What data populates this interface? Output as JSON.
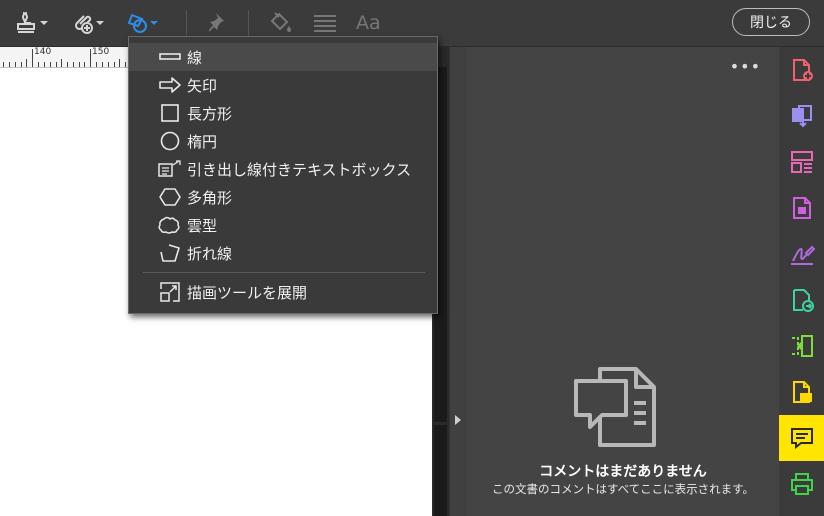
{
  "toolbar": {
    "icons": [
      "stamp-icon",
      "attach-icon",
      "draw-shapes-icon",
      "pin-icon",
      "fill-icon",
      "line-style-icon",
      "font-icon"
    ],
    "font_label": "Aa",
    "close_label": "閉じる"
  },
  "ruler": {
    "labels": [
      "140",
      "150"
    ]
  },
  "menu": {
    "items": [
      {
        "icon": "line-icon",
        "label": "線"
      },
      {
        "icon": "arrow-icon",
        "label": "矢印"
      },
      {
        "icon": "rectangle-icon",
        "label": "長方形"
      },
      {
        "icon": "ellipse-icon",
        "label": "楕円"
      },
      {
        "icon": "text-callout-icon",
        "label": "引き出し線付きテキストボックス"
      },
      {
        "icon": "polygon-icon",
        "label": "多角形"
      },
      {
        "icon": "cloud-icon",
        "label": "雲型"
      },
      {
        "icon": "polyline-icon",
        "label": "折れ線"
      }
    ],
    "expand_label": "描画ツールを展開"
  },
  "comments": {
    "more": "•••",
    "empty_title": "コメントはまだありません",
    "empty_subtitle": "この文書のコメントはすべてここに表示されます。"
  },
  "rail": {
    "items": [
      "export-pdf-icon",
      "create-pdf-icon",
      "organize-pages-icon",
      "edit-pdf-icon",
      "fill-sign-icon",
      "export-icon",
      "compress-icon",
      "sticky-note-icon",
      "comment-icon",
      "print-production-icon"
    ],
    "colors": {
      "red": "#f0606d",
      "purple": "#9b8ff0",
      "pink": "#e868b8",
      "magenta": "#d160e0",
      "green": "#3fd2a0",
      "lime": "#7ddc3a",
      "yellow": "#ffd800",
      "active_bg": "#ffe500"
    }
  }
}
